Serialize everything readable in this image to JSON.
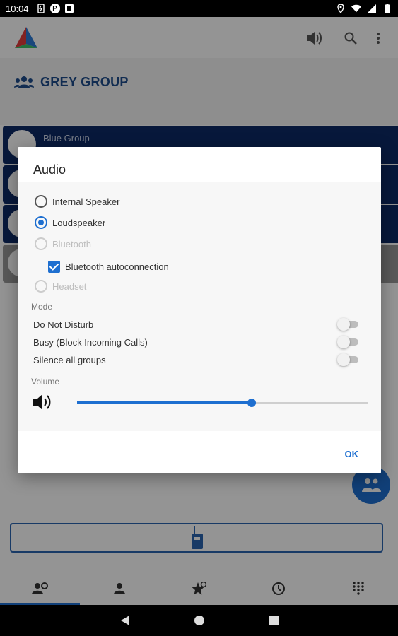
{
  "status_bar": {
    "time": "10:04"
  },
  "group": {
    "title": "GREY GROUP"
  },
  "groups": [
    {
      "name": "Blue Group"
    }
  ],
  "dialog": {
    "title": "Audio",
    "options": [
      {
        "label": "Internal Speaker",
        "state": "unchecked"
      },
      {
        "label": "Loudspeaker",
        "state": "checked"
      },
      {
        "label": "Bluetooth",
        "state": "disabled"
      },
      {
        "label": "Headset",
        "state": "disabled"
      }
    ],
    "bluetooth_autoconnection": {
      "label": "Bluetooth autoconnection",
      "checked": true
    },
    "mode_label": "Mode",
    "modes": [
      {
        "label": "Do Not Disturb",
        "on": false
      },
      {
        "label": "Busy (Block Incoming Calls)",
        "on": false
      },
      {
        "label": "Silence all groups",
        "on": false
      }
    ],
    "volume_label": "Volume",
    "volume_level": 0.6,
    "ok_label": "OK"
  },
  "colors": {
    "accent": "#1e6fd0",
    "group_title": "#1e4d8c",
    "group_row": "#0d2a66"
  },
  "bottom_nav": [
    {
      "icon": "groups-icon",
      "active": true
    },
    {
      "icon": "contact-icon",
      "active": false
    },
    {
      "icon": "favorites-icon",
      "active": false
    },
    {
      "icon": "history-icon",
      "active": false
    },
    {
      "icon": "dialpad-icon",
      "active": false
    }
  ]
}
